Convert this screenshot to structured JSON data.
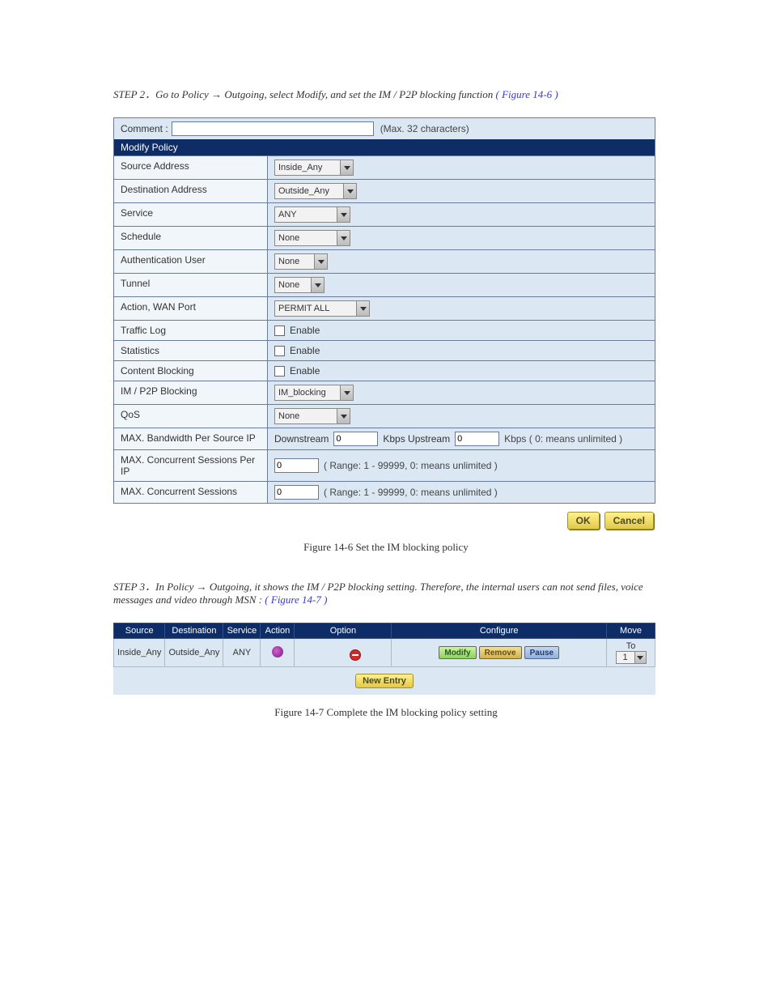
{
  "step1": {
    "prefix": "STEP 2．Go to Policy",
    "arrow": "→",
    "tail": "Outgoing, select Modify, and set the IM / P2P blocking function",
    "paren": "( Figure 14-6 )"
  },
  "form": {
    "comment_label": "Comment :",
    "comment_value": "",
    "comment_hint": "(Max. 32 characters)",
    "header": "Modify Policy",
    "rows": {
      "src": {
        "label": "Source Address",
        "value": "Inside_Any"
      },
      "dst": {
        "label": "Destination Address",
        "value": "Outside_Any"
      },
      "svc": {
        "label": "Service",
        "value": "ANY"
      },
      "sched": {
        "label": "Schedule",
        "value": "None"
      },
      "auth": {
        "label": "Authentication User",
        "value": "None"
      },
      "tun": {
        "label": "Tunnel",
        "value": "None"
      },
      "action": {
        "label": "Action, WAN Port",
        "value": "PERMIT ALL"
      },
      "tlog": {
        "label": "Traffic Log",
        "cb_label": "Enable"
      },
      "stats": {
        "label": "Statistics",
        "cb_label": "Enable"
      },
      "cblock": {
        "label": "Content Blocking",
        "cb_label": "Enable"
      },
      "imp2p": {
        "label": "IM / P2P Blocking",
        "value": "IM_blocking"
      },
      "qos": {
        "label": "QoS",
        "value": "None"
      },
      "maxbw": {
        "label": "MAX. Bandwidth Per Source IP",
        "down_label": "Downstream",
        "down_val": "0",
        "mid1": "Kbps Upstream",
        "up_val": "0",
        "tail": "Kbps ( 0: means unlimited )"
      },
      "maxcsip": {
        "label": "MAX. Concurrent Sessions Per IP",
        "val": "0",
        "hint": "( Range: 1 - 99999, 0: means unlimited )"
      },
      "maxcs": {
        "label": "MAX. Concurrent Sessions",
        "val": "0",
        "hint": "( Range: 1 - 99999, 0: means unlimited )"
      }
    },
    "buttons": {
      "ok": "OK",
      "cancel": "Cancel"
    }
  },
  "figcap1": "Figure 14-6   Set the IM blocking policy",
  "step2": {
    "prefix": "STEP 3．In Policy",
    "arrow": "→",
    "tail": "Outgoing, it shows the IM / P2P blocking setting. Therefore, the internal users can not send files, voice messages and video through MSN",
    "colon": ":",
    "paren": "( Figure 14-7 )"
  },
  "policy_table": {
    "headers": {
      "src": "Source",
      "dst": "Destination",
      "svc": "Service",
      "action": "Action",
      "option": "Option",
      "config": "Configure",
      "move": "Move"
    },
    "row": {
      "src": "Inside_Any",
      "dst": "Outside_Any",
      "svc": "ANY",
      "move_label": "To",
      "move_value": "1"
    },
    "config_btns": {
      "modify": "Modify",
      "remove": "Remove",
      "pause": "Pause"
    },
    "new_entry": "New Entry"
  },
  "figcap2": "Figure 14-7   Complete the IM blocking policy setting"
}
